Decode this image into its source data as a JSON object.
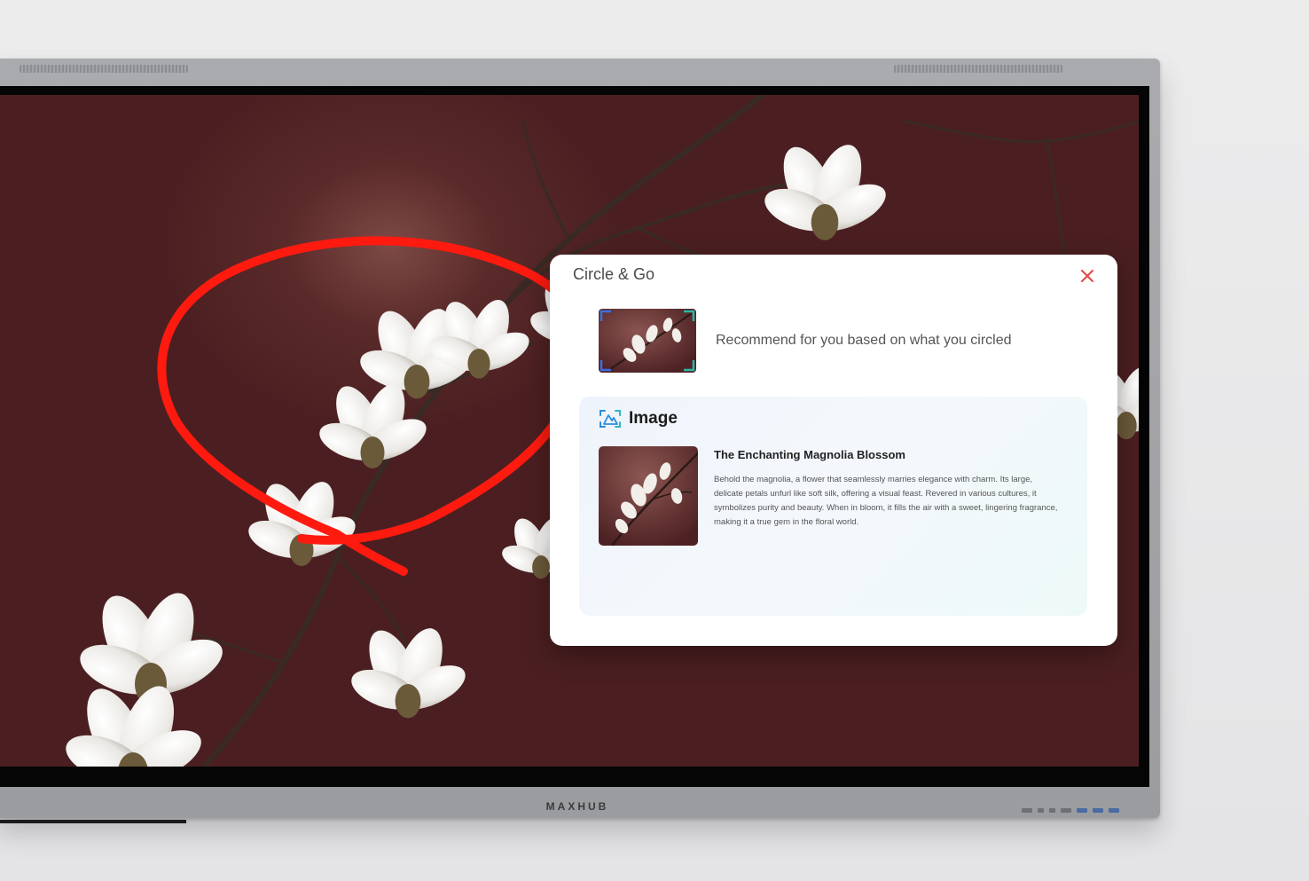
{
  "panel": {
    "title": "Circle & Go",
    "recommend_text": "Recommend for you based on what you circled"
  },
  "result": {
    "category_label": "Image",
    "title": "The Enchanting Magnolia Blossom",
    "description": "Behold the magnolia, a flower that seamlessly marries elegance with charm. Its large, delicate petals unfurl like soft silk, offering a visual feast. Revered in various cultures, it symbolizes purity and beauty. When in bloom, it fills the air with a sweet, lingering fragrance, making it a true gem in the floral world."
  },
  "device": {
    "brand": "MAXHUB"
  },
  "icons": {
    "close": "close-icon",
    "image_search": "image-search-icon"
  },
  "colors": {
    "annotation_stroke": "#ff1a10",
    "close_icon": "#e44646",
    "screen_background": "#4b1f21",
    "image_icon": "#2b8de0"
  }
}
